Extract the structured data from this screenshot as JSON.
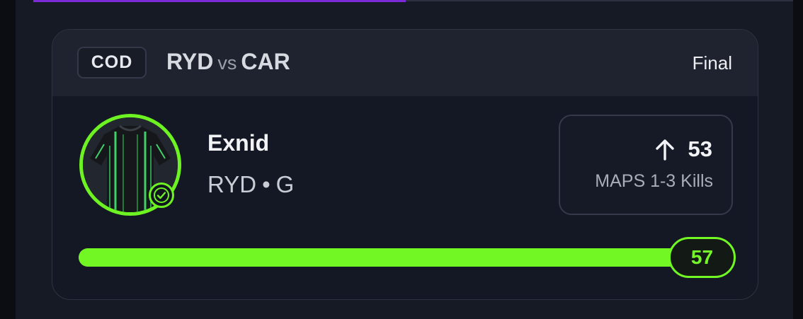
{
  "header": {
    "sport": "COD",
    "team_home": "RYD",
    "vs": "vs",
    "team_away": "CAR",
    "status": "Final"
  },
  "player": {
    "name": "Exnid",
    "team": "RYD",
    "separator": "•",
    "position": "G",
    "verified": true
  },
  "projection": {
    "direction": "up",
    "line": "53",
    "stat_label": "MAPS 1-3 Kills"
  },
  "result": {
    "actual": "57",
    "progress_fraction": 1.0
  },
  "colors": {
    "accent_green": "#72f724",
    "top_accent_purple": "#7a2bd6",
    "card_bg": "#141824",
    "header_bg": "#1f2330"
  },
  "icons": {
    "direction_icon": "arrow-up-icon",
    "verified_icon": "check-circle-icon",
    "avatar_icon": "jersey-icon"
  }
}
